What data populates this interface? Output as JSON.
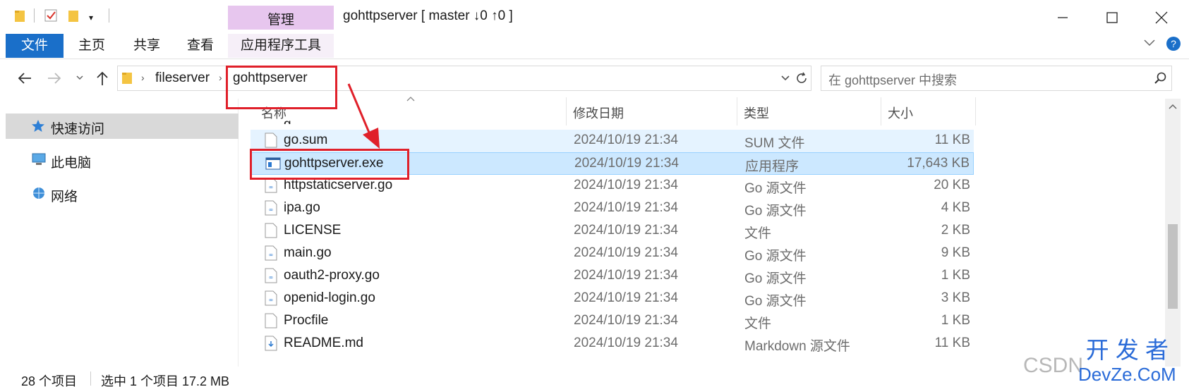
{
  "window": {
    "title": "gohttpserver [ master ↓0 ↑0 ]",
    "manage_label": "管理"
  },
  "ribbon": {
    "tabs": [
      "文件",
      "主页",
      "共享",
      "查看",
      "应用程序工具"
    ]
  },
  "address": {
    "segments": [
      "fileserver",
      "gohttpserver"
    ],
    "search_placeholder": "在 gohttpserver 中搜索"
  },
  "navpane": {
    "items": [
      "快速访问",
      "此电脑",
      "网络"
    ]
  },
  "columns": {
    "name": "名称",
    "date": "修改日期",
    "type": "类型",
    "size": "大小"
  },
  "files": [
    {
      "name": "go.sum",
      "date": "2024/10/19 21:34",
      "type": "SUM 文件",
      "size": "11 KB",
      "icon": "file-icon",
      "state": "hover"
    },
    {
      "name": "gohttpserver.exe",
      "date": "2024/10/19 21:34",
      "type": "应用程序",
      "size": "17,643 KB",
      "icon": "exe-icon",
      "state": "selected"
    },
    {
      "name": "httpstaticserver.go",
      "date": "2024/10/19 21:34",
      "type": "Go 源文件",
      "size": "20 KB",
      "icon": "go-file-icon"
    },
    {
      "name": "ipa.go",
      "date": "2024/10/19 21:34",
      "type": "Go 源文件",
      "size": "4 KB",
      "icon": "go-file-icon"
    },
    {
      "name": "LICENSE",
      "date": "2024/10/19 21:34",
      "type": "文件",
      "size": "2 KB",
      "icon": "file-icon"
    },
    {
      "name": "main.go",
      "date": "2024/10/19 21:34",
      "type": "Go 源文件",
      "size": "9 KB",
      "icon": "go-file-icon"
    },
    {
      "name": "oauth2-proxy.go",
      "date": "2024/10/19 21:34",
      "type": "Go 源文件",
      "size": "1 KB",
      "icon": "go-file-icon"
    },
    {
      "name": "openid-login.go",
      "date": "2024/10/19 21:34",
      "type": "Go 源文件",
      "size": "3 KB",
      "icon": "go-file-icon"
    },
    {
      "name": "Procfile",
      "date": "2024/10/19 21:34",
      "type": "文件",
      "size": "1 KB",
      "icon": "file-icon"
    },
    {
      "name": "README.md",
      "date": "2024/10/19 21:34",
      "type": "Markdown 源文件",
      "size": "11 KB",
      "icon": "md-file-icon"
    }
  ],
  "status": {
    "item_count": "28 个项目",
    "selection": "选中 1 个项目 17.2 MB"
  },
  "watermark": {
    "csdn": "CSDN",
    "devze_top": "开 发 者",
    "devze_bottom": "DevZe.CoM"
  },
  "colors": {
    "accent": "#1a6fc9",
    "manage_tab": "#e7c6ee",
    "selected_row": "#cce8ff",
    "hover_row": "#e5f3ff",
    "annotation_red": "#e0202a"
  }
}
